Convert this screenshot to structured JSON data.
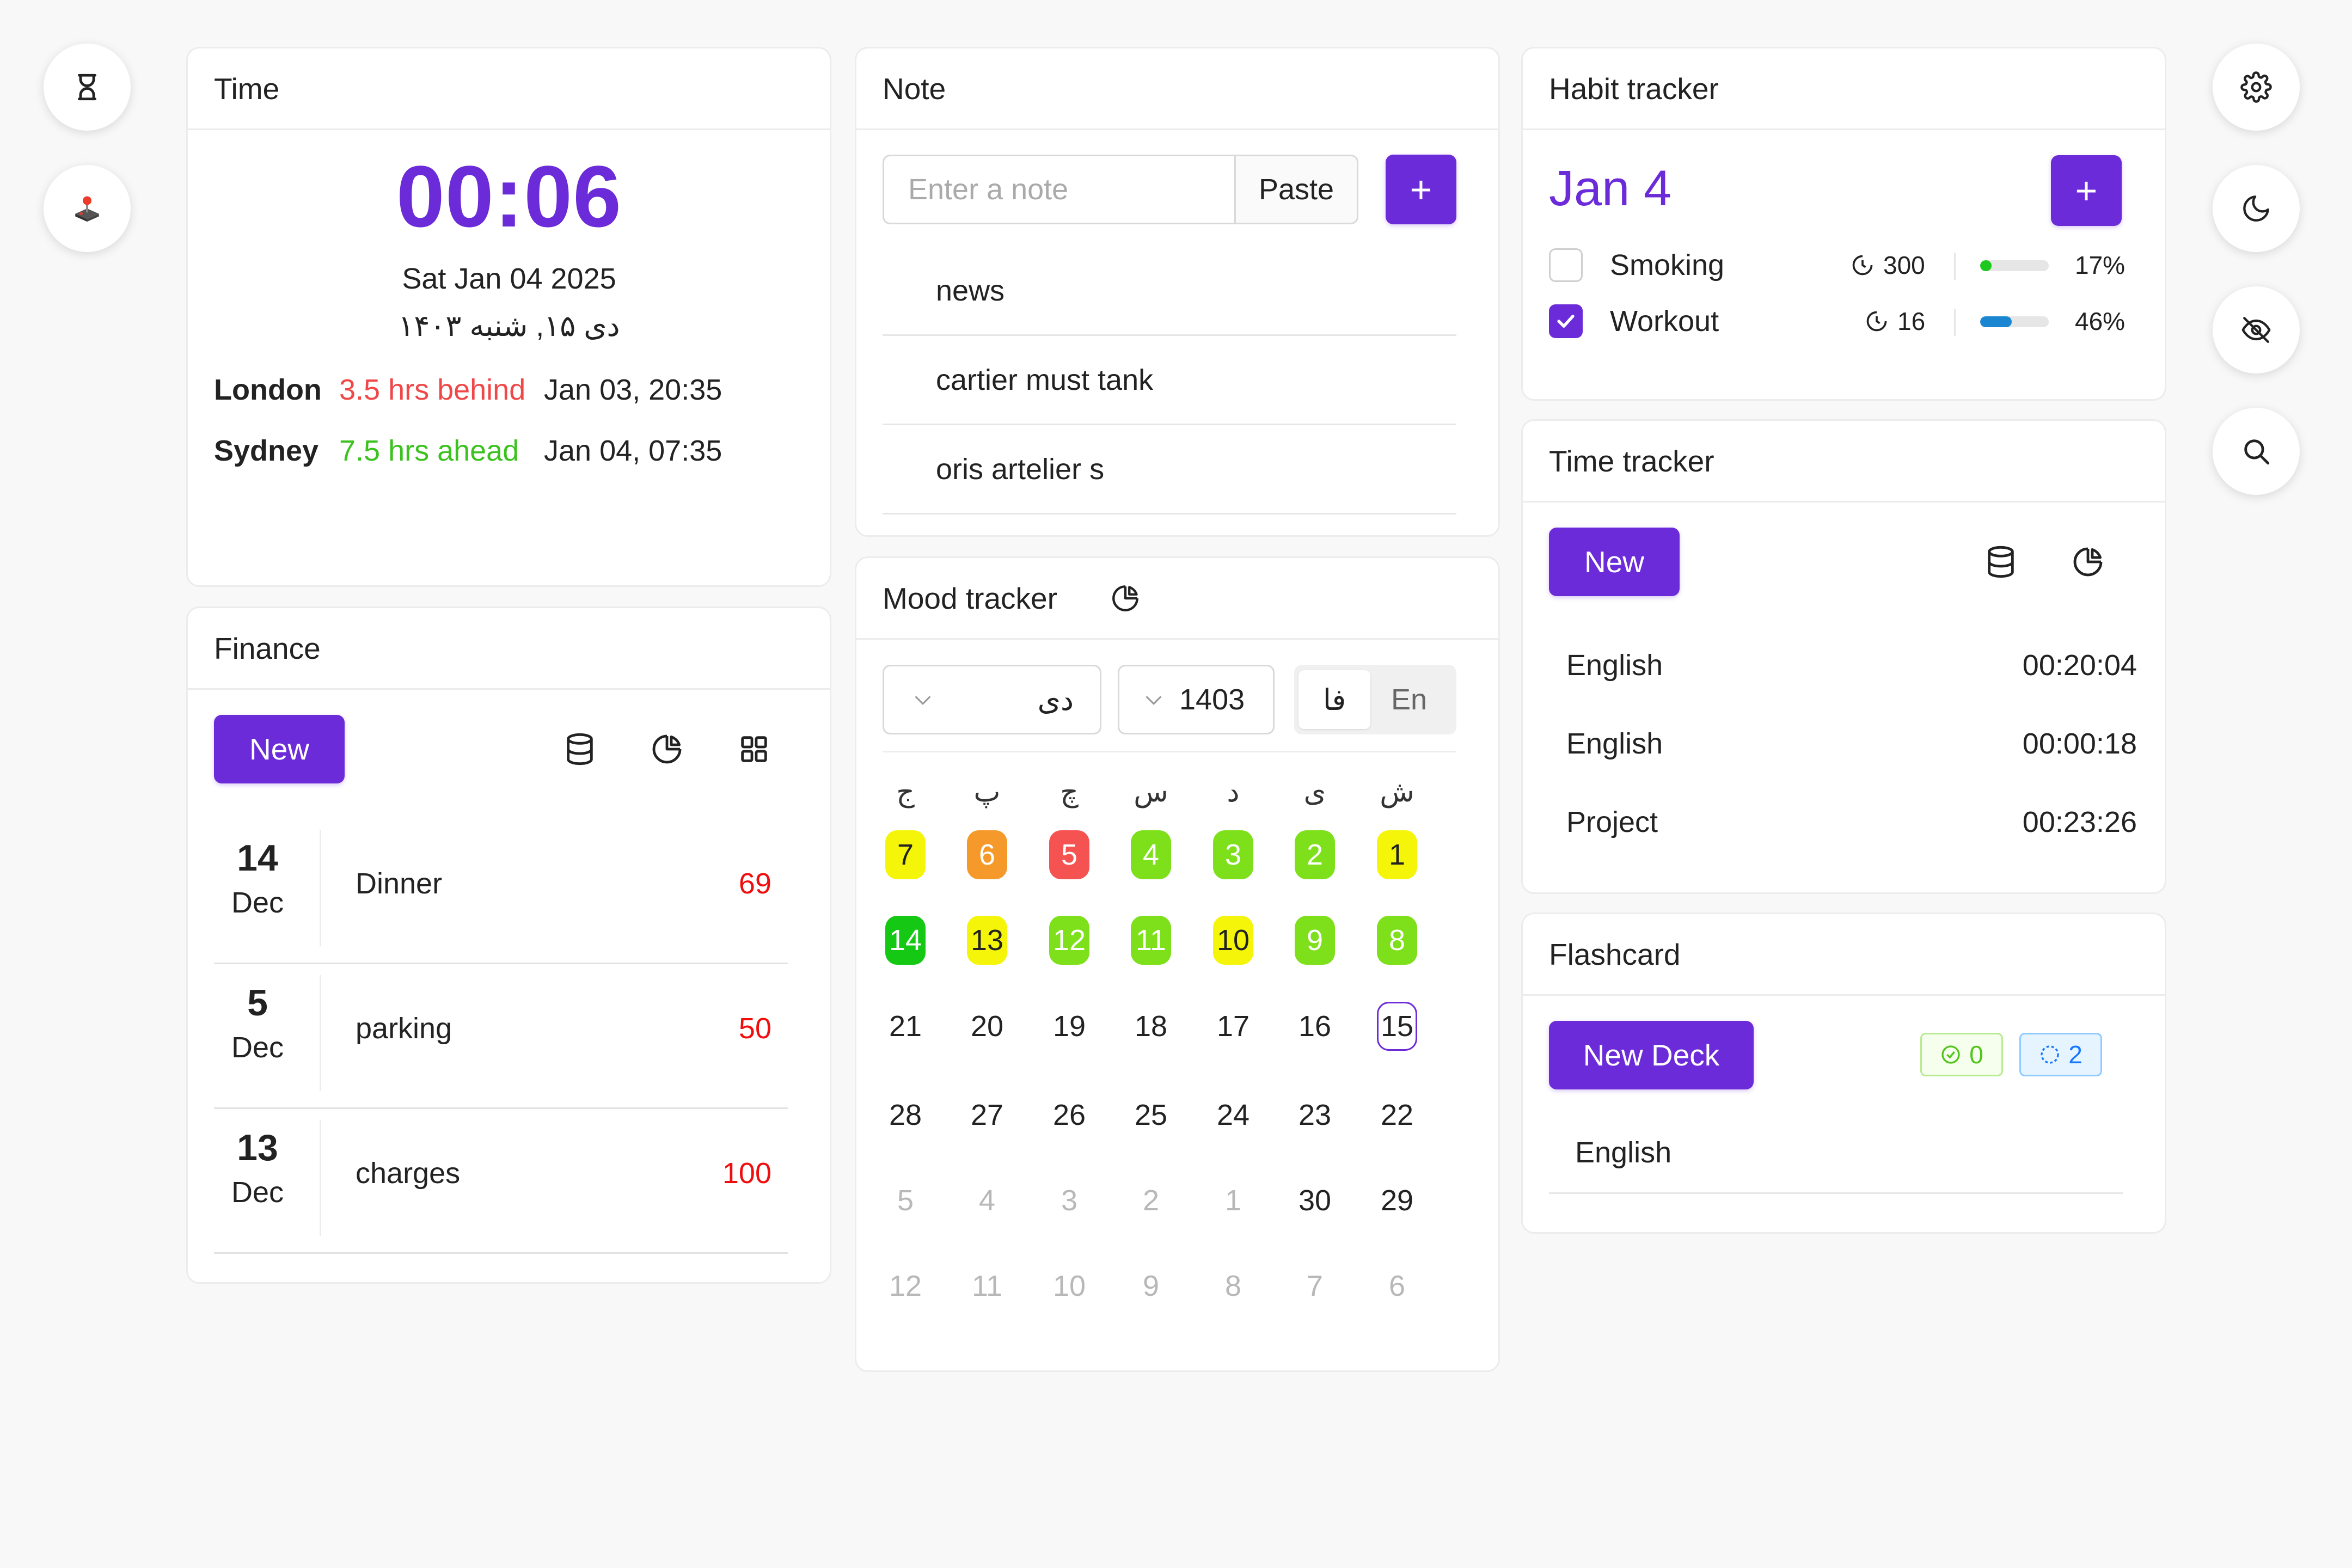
{
  "left_fabs": [
    {
      "icon": "hourglass-icon"
    },
    {
      "icon": "joystick-icon"
    }
  ],
  "right_fabs": [
    {
      "icon": "gear-icon"
    },
    {
      "icon": "moon-icon"
    },
    {
      "icon": "eye-off-icon"
    },
    {
      "icon": "search-icon"
    }
  ],
  "time": {
    "title": "Time",
    "clock": "00:06",
    "date": "Sat Jan 04 2025",
    "persian_date": "دی ۱۵, شنبه ۱۴۰۳",
    "zones": [
      {
        "city": "London",
        "diff": "3.5 hrs behind",
        "time": "Jan 03, 20:35"
      },
      {
        "city": "Sydney",
        "diff": "7.5 hrs ahead",
        "time": "Jan 04, 07:35"
      }
    ]
  },
  "finance": {
    "title": "Finance",
    "new_label": "New",
    "rows": [
      {
        "day": "14",
        "month": "Dec",
        "title": "Dinner",
        "amount": "69"
      },
      {
        "day": "5",
        "month": "Dec",
        "title": "parking",
        "amount": "50"
      },
      {
        "day": "13",
        "month": "Dec",
        "title": "charges",
        "amount": "100"
      }
    ]
  },
  "note": {
    "title": "Note",
    "input_placeholder": "Enter a note",
    "paste_label": "Paste",
    "add_label": "+",
    "items": [
      "news",
      "cartier must tank",
      "oris artelier s"
    ]
  },
  "mood": {
    "title": "Mood tracker",
    "month_value": "دی",
    "year_value": "1403",
    "lang_fa": "فا",
    "lang_en": "En",
    "weekdays": [
      "ج",
      "پ",
      "چ",
      "س",
      "د",
      "ی",
      "ش"
    ],
    "weeks": [
      [
        {
          "d": "7",
          "c": "#f5f50a"
        },
        {
          "d": "6",
          "c": "#f59a2a"
        },
        {
          "d": "5",
          "c": "#f55252"
        },
        {
          "d": "4",
          "c": "#7de01a"
        },
        {
          "d": "3",
          "c": "#7de01a"
        },
        {
          "d": "2",
          "c": "#7de01a"
        },
        {
          "d": "1",
          "c": "#f5f50a"
        }
      ],
      [
        {
          "d": "14",
          "c": "#14c814"
        },
        {
          "d": "13",
          "c": "#f5f50a"
        },
        {
          "d": "12",
          "c": "#7de01a"
        },
        {
          "d": "11",
          "c": "#7de01a"
        },
        {
          "d": "10",
          "c": "#f5f50a"
        },
        {
          "d": "9",
          "c": "#7de01a"
        },
        {
          "d": "8",
          "c": "#7de01a"
        }
      ],
      [
        {
          "d": "21"
        },
        {
          "d": "20"
        },
        {
          "d": "19"
        },
        {
          "d": "18"
        },
        {
          "d": "17"
        },
        {
          "d": "16"
        },
        {
          "d": "15",
          "today": true
        }
      ],
      [
        {
          "d": "28"
        },
        {
          "d": "27"
        },
        {
          "d": "26"
        },
        {
          "d": "25"
        },
        {
          "d": "24"
        },
        {
          "d": "23"
        },
        {
          "d": "22"
        }
      ],
      [
        {
          "d": "5",
          "muted": true
        },
        {
          "d": "4",
          "muted": true
        },
        {
          "d": "3",
          "muted": true
        },
        {
          "d": "2",
          "muted": true
        },
        {
          "d": "1",
          "muted": true
        },
        {
          "d": "30"
        },
        {
          "d": "29"
        }
      ],
      [
        {
          "d": "12",
          "muted": true
        },
        {
          "d": "11",
          "muted": true
        },
        {
          "d": "10",
          "muted": true
        },
        {
          "d": "9",
          "muted": true
        },
        {
          "d": "8",
          "muted": true
        },
        {
          "d": "7",
          "muted": true
        },
        {
          "d": "6",
          "muted": true
        }
      ]
    ]
  },
  "habit": {
    "title": "Habit tracker",
    "date": "Jan 4",
    "add_label": "+",
    "items": [
      {
        "name": "Smoking",
        "checked": false,
        "count": "300",
        "pct": "17%",
        "progress": 0.17,
        "color": "#1ec81e"
      },
      {
        "name": "Workout",
        "checked": true,
        "count": "16",
        "pct": "46%",
        "progress": 0.46,
        "color": "#1a86d1"
      }
    ]
  },
  "timetracker": {
    "title": "Time tracker",
    "new_label": "New",
    "rows": [
      {
        "name": "English",
        "time": "00:20:04"
      },
      {
        "name": "English",
        "time": "00:00:18"
      },
      {
        "name": "Project",
        "time": "00:23:26"
      }
    ]
  },
  "flashcard": {
    "title": "Flashcard",
    "new_label": "New Deck",
    "done_count": "0",
    "pending_count": "2",
    "decks": [
      "English"
    ]
  },
  "colors": {
    "accent": "#6c2bd9",
    "negative": "#f04848",
    "positive": "#3cc21f",
    "expense": "#f00d0d"
  }
}
